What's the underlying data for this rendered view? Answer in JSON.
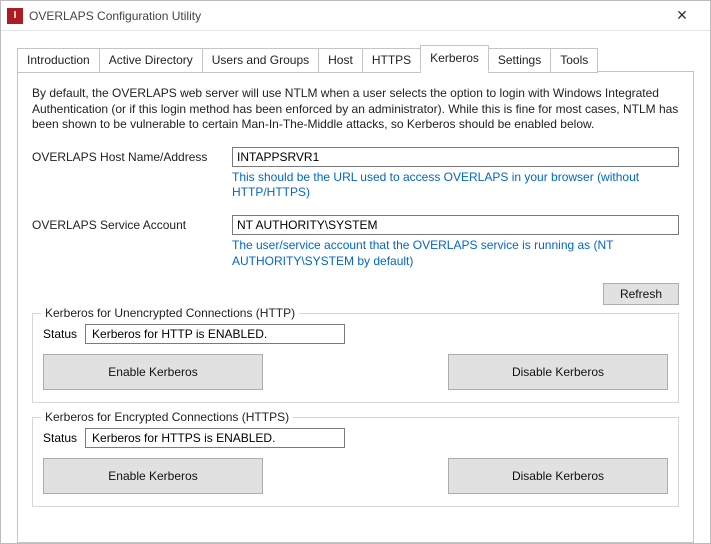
{
  "window": {
    "title": "OVERLAPS Configuration Utility",
    "icon_letter": "I"
  },
  "tabs": [
    "Introduction",
    "Active Directory",
    "Users and Groups",
    "Host",
    "HTTPS",
    "Kerberos",
    "Settings",
    "Tools"
  ],
  "active_tab": "Kerberos",
  "intro_text": "By default, the OVERLAPS web server will use NTLM when a user selects the option to login with Windows Integrated Authentication (or if this login method has been enforced by an administrator). While this is fine for most cases, NTLM has been shown to be vulnerable to certain Man-In-The-Middle attacks, so Kerberos should be enabled below.",
  "fields": {
    "host": {
      "label": "OVERLAPS Host Name/Address",
      "value": "INTAPPSRVR1",
      "hint": "This should be the URL used to access OVERLAPS in your browser (without HTTP/HTTPS)"
    },
    "svc": {
      "label": "OVERLAPS Service Account",
      "value": "NT AUTHORITY\\SYSTEM",
      "hint": "The user/service account that the OVERLAPS service is running as (NT AUTHORITY\\SYSTEM by default)"
    }
  },
  "refresh_label": "Refresh",
  "http_group": {
    "title": "Kerberos for Unencrypted Connections (HTTP)",
    "status_label": "Status",
    "status_value": "Kerberos for HTTP is ENABLED.",
    "enable_label": "Enable Kerberos",
    "disable_label": "Disable Kerberos"
  },
  "https_group": {
    "title": "Kerberos for Encrypted Connections (HTTPS)",
    "status_label": "Status",
    "status_value": "Kerberos for HTTPS is ENABLED.",
    "enable_label": "Enable Kerberos",
    "disable_label": "Disable Kerberos"
  }
}
